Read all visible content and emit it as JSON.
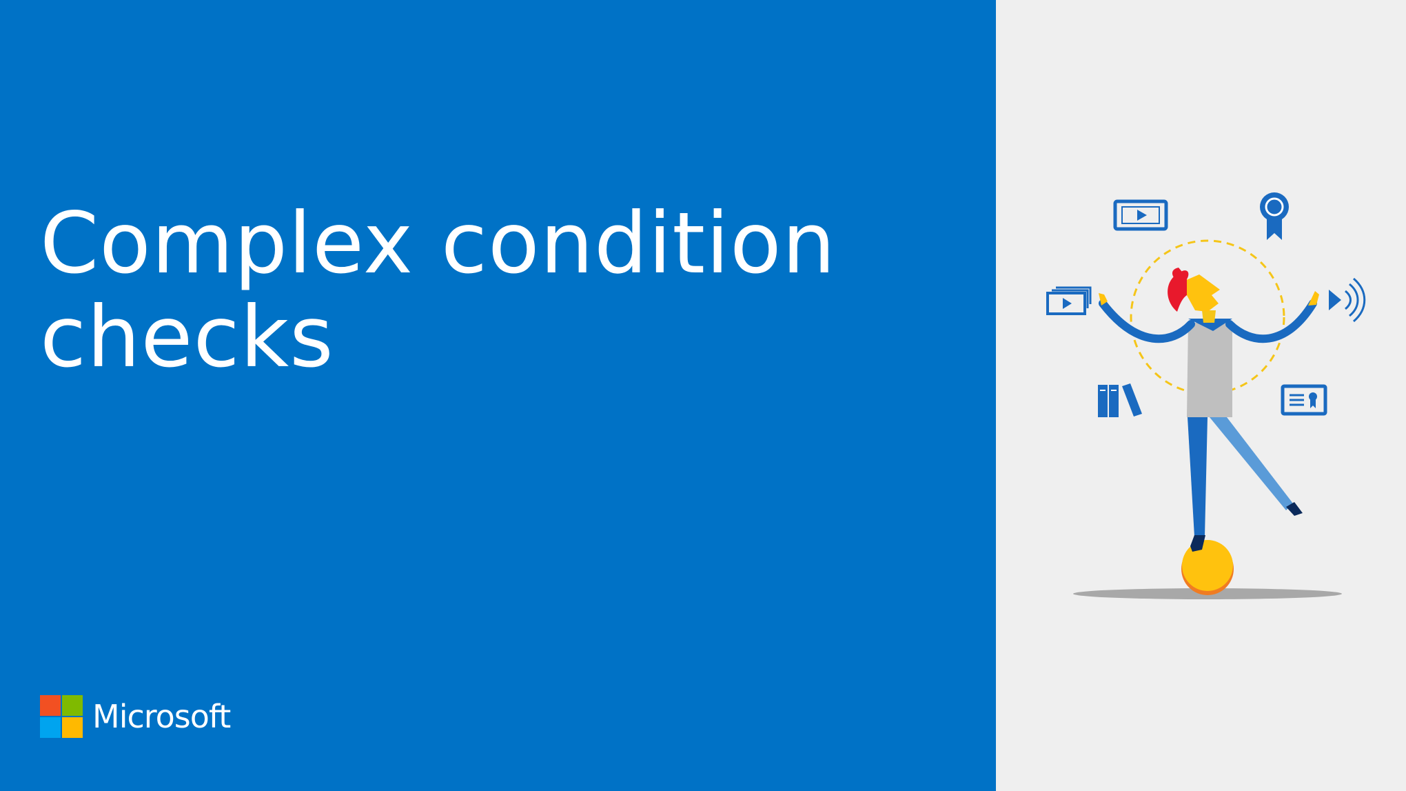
{
  "slide": {
    "title_line1": "Complex condition",
    "title_line2": "checks"
  },
  "brand": {
    "name": "Microsoft",
    "logo_colors": [
      "#f25022",
      "#7fba00",
      "#00a4ef",
      "#ffb900"
    ]
  },
  "colors": {
    "accent_blue": "#0072c6",
    "panel_grey": "#efefef"
  },
  "illustration": {
    "figure": "person-balancing-on-ball-icon",
    "icons": [
      "video-play-icon",
      "award-ribbon-icon",
      "video-stack-icon",
      "audio-speaker-icon",
      "books-icon",
      "certificate-icon"
    ]
  }
}
